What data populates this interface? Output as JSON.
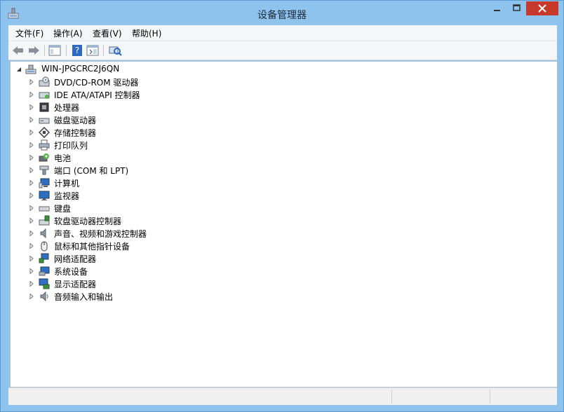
{
  "window": {
    "title": "设备管理器"
  },
  "menu": [
    {
      "label": "文件(F)"
    },
    {
      "label": "操作(A)"
    },
    {
      "label": "查看(V)"
    },
    {
      "label": "帮助(H)"
    }
  ],
  "toolbar": [
    {
      "name": "back-button",
      "icon": "arrow-left-icon"
    },
    {
      "name": "forward-button",
      "icon": "arrow-right-icon"
    },
    {
      "name": "show-hide-console-tree-button",
      "icon": "console-tree-icon"
    },
    {
      "name": "help-button",
      "icon": "help-icon"
    },
    {
      "name": "properties-button",
      "icon": "properties-icon"
    },
    {
      "name": "scan-hardware-button",
      "icon": "scan-hardware-icon"
    }
  ],
  "tree": {
    "root": {
      "label": "WIN-JPGCRC2J6QN",
      "icon": "computer-icon"
    },
    "nodes": [
      {
        "label": "DVD/CD-ROM 驱动器",
        "icon": "dvd-drive-icon"
      },
      {
        "label": "IDE ATA/ATAPI 控制器",
        "icon": "ide-controller-icon"
      },
      {
        "label": "处理器",
        "icon": "processor-icon"
      },
      {
        "label": "磁盘驱动器",
        "icon": "disk-drive-icon"
      },
      {
        "label": "存储控制器",
        "icon": "storage-controller-icon"
      },
      {
        "label": "打印队列",
        "icon": "printer-icon"
      },
      {
        "label": "电池",
        "icon": "battery-icon"
      },
      {
        "label": "端口 (COM 和 LPT)",
        "icon": "port-icon"
      },
      {
        "label": "计算机",
        "icon": "computer-icon"
      },
      {
        "label": "监视器",
        "icon": "monitor-icon"
      },
      {
        "label": "键盘",
        "icon": "keyboard-icon"
      },
      {
        "label": "软盘驱动器控制器",
        "icon": "floppy-controller-icon"
      },
      {
        "label": "声音、视频和游戏控制器",
        "icon": "speaker-icon"
      },
      {
        "label": "鼠标和其他指针设备",
        "icon": "mouse-icon"
      },
      {
        "label": "网络适配器",
        "icon": "network-adapter-icon"
      },
      {
        "label": "系统设备",
        "icon": "system-devices-icon"
      },
      {
        "label": "显示适配器",
        "icon": "display-adapter-icon"
      },
      {
        "label": "音频输入和输出",
        "icon": "audio-io-icon"
      }
    ]
  }
}
